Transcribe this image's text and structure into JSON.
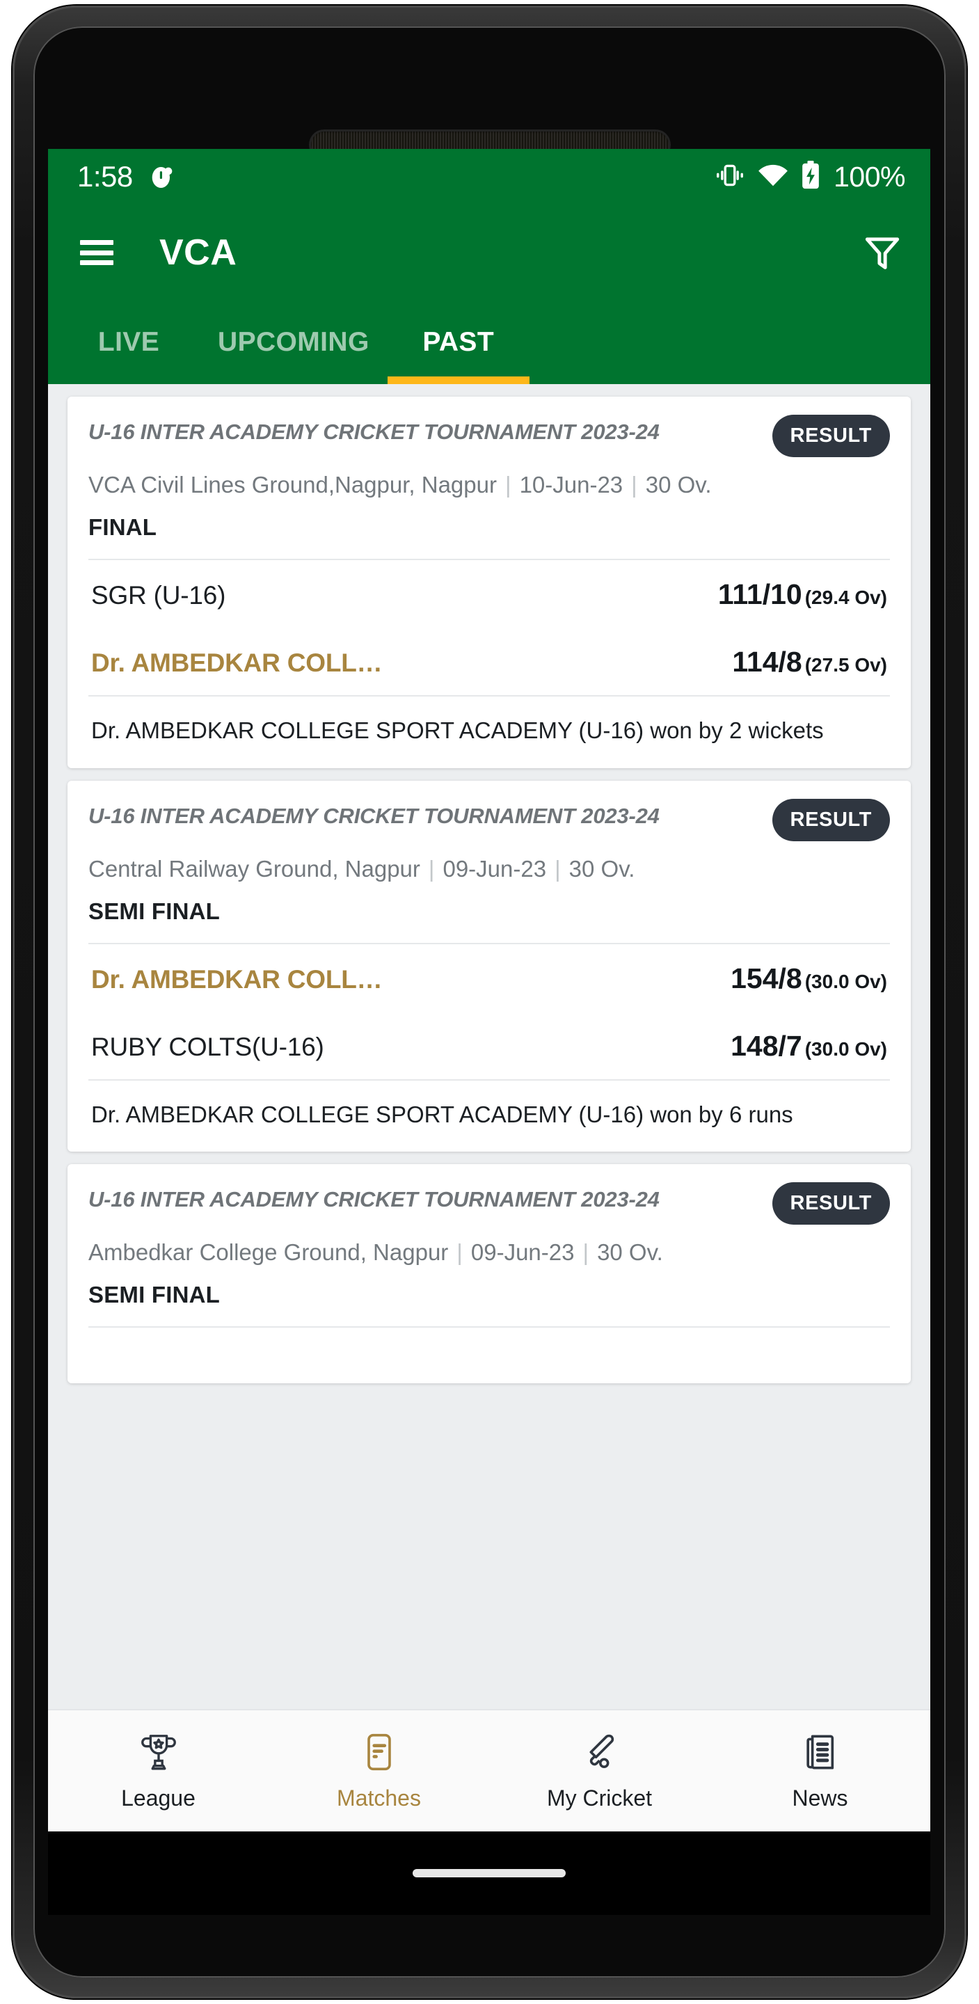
{
  "status_bar": {
    "time": "1:58",
    "alarm_icon": "alarm-icon",
    "vibrate_icon": "vibrate-icon",
    "wifi_icon": "wifi-icon",
    "battery_icon": "battery-charging-icon",
    "battery_percent": "100%"
  },
  "app_bar": {
    "menu_icon": "hamburger-menu-icon",
    "title": "VCA",
    "filter_icon": "filter-funnel-icon"
  },
  "tabs": [
    {
      "label": "LIVE",
      "active": false
    },
    {
      "label": "UPCOMING",
      "active": false
    },
    {
      "label": "PAST",
      "active": true
    }
  ],
  "matches": [
    {
      "tournament": "U-16 INTER ACADEMY CRICKET TOURNAMENT 2023-24",
      "badge": "RESULT",
      "venue": "VCA Civil Lines Ground,Nagpur, Nagpur",
      "date": "10-Jun-23",
      "overs": "30 Ov.",
      "stage": "FINAL",
      "teams": [
        {
          "name": "SGR (U-16)",
          "score": "111/10",
          "overs": "(29.4 Ov)",
          "winner": false
        },
        {
          "name": "Dr. AMBEDKAR COLL…",
          "score": "114/8",
          "overs": "(27.5 Ov)",
          "winner": true
        }
      ],
      "result": "Dr. AMBEDKAR COLLEGE SPORT ACADEMY (U-16) won by 2 wickets"
    },
    {
      "tournament": "U-16 INTER ACADEMY CRICKET TOURNAMENT 2023-24",
      "badge": "RESULT",
      "venue": "Central Railway Ground, Nagpur",
      "date": "09-Jun-23",
      "overs": "30 Ov.",
      "stage": "SEMI FINAL",
      "teams": [
        {
          "name": "Dr. AMBEDKAR COLL…",
          "score": "154/8",
          "overs": "(30.0 Ov)",
          "winner": true
        },
        {
          "name": "RUBY COLTS(U-16)",
          "score": "148/7",
          "overs": "(30.0 Ov)",
          "winner": false
        }
      ],
      "result": "Dr. AMBEDKAR COLLEGE SPORT ACADEMY (U-16) won by 6 runs"
    },
    {
      "tournament": "U-16 INTER ACADEMY CRICKET TOURNAMENT 2023-24",
      "badge": "RESULT",
      "venue": "Ambedkar College Ground, Nagpur",
      "date": "09-Jun-23",
      "overs": "30 Ov.",
      "stage": "SEMI FINAL",
      "teams": [],
      "result": ""
    }
  ],
  "bottom_nav": [
    {
      "label": "League",
      "icon": "trophy-icon",
      "active": false
    },
    {
      "label": "Matches",
      "icon": "document-icon",
      "active": true
    },
    {
      "label": "My Cricket",
      "icon": "cricket-bat-icon",
      "active": false
    },
    {
      "label": "News",
      "icon": "newspaper-icon",
      "active": false
    }
  ],
  "colors": {
    "brand_green": "#00742f",
    "accent_yellow": "#FDB71A",
    "winner_gold": "#a8853f",
    "badge_dark": "#2f3640"
  }
}
